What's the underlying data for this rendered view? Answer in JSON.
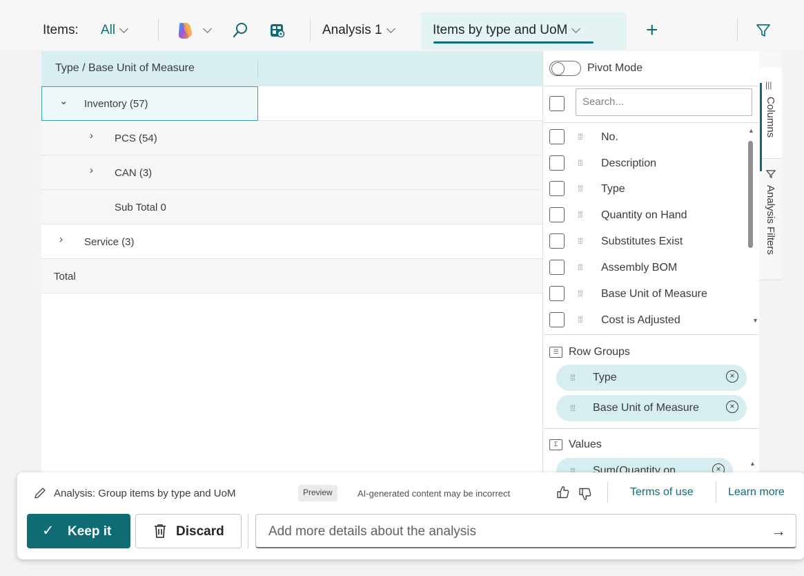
{
  "toolbar": {
    "items_label": "Items:",
    "filter_value": "All",
    "view_name": "Analysis 1",
    "active_tab": "Items by type and UoM",
    "add_symbol": "+"
  },
  "grid": {
    "header": "Type / Base Unit of Measure",
    "rows": [
      {
        "label": "Inventory (57)",
        "expander": "⌄"
      },
      {
        "label": "PCS (54)",
        "expander": "›"
      },
      {
        "label": "CAN (3)",
        "expander": "›"
      },
      {
        "label": "Sub Total 0",
        "expander": ""
      },
      {
        "label": "Service (3)",
        "expander": "›"
      },
      {
        "label": "Total",
        "expander": ""
      }
    ]
  },
  "panel": {
    "pivot_mode_label": "Pivot Mode",
    "search_placeholder": "Search...",
    "columns": [
      "No.",
      "Description",
      "Type",
      "Quantity on Hand",
      "Substitutes Exist",
      "Assembly BOM",
      "Base Unit of Measure",
      "Cost is Adjusted"
    ],
    "row_groups_title": "Row Groups",
    "row_groups": [
      "Type",
      "Base Unit of Measure"
    ],
    "values_title": "Values",
    "values": [
      "Sum(Quantity on..."
    ],
    "tabs": [
      "Columns",
      "Analysis Filters"
    ]
  },
  "bottom_bar": {
    "analysis_text": "Analysis: Group items by type and UoM",
    "badge": "Preview",
    "disclaimer": "AI-generated content may be incorrect",
    "terms_link": "Terms of use",
    "learn_link": "Learn more",
    "keep_label": "Keep it",
    "discard_label": "Discard",
    "details_placeholder": "Add more details about the analysis"
  },
  "colors": {
    "accent": "#0f6c74",
    "header_bg": "#d9eef0",
    "pill_bg": "#d7eef0"
  }
}
